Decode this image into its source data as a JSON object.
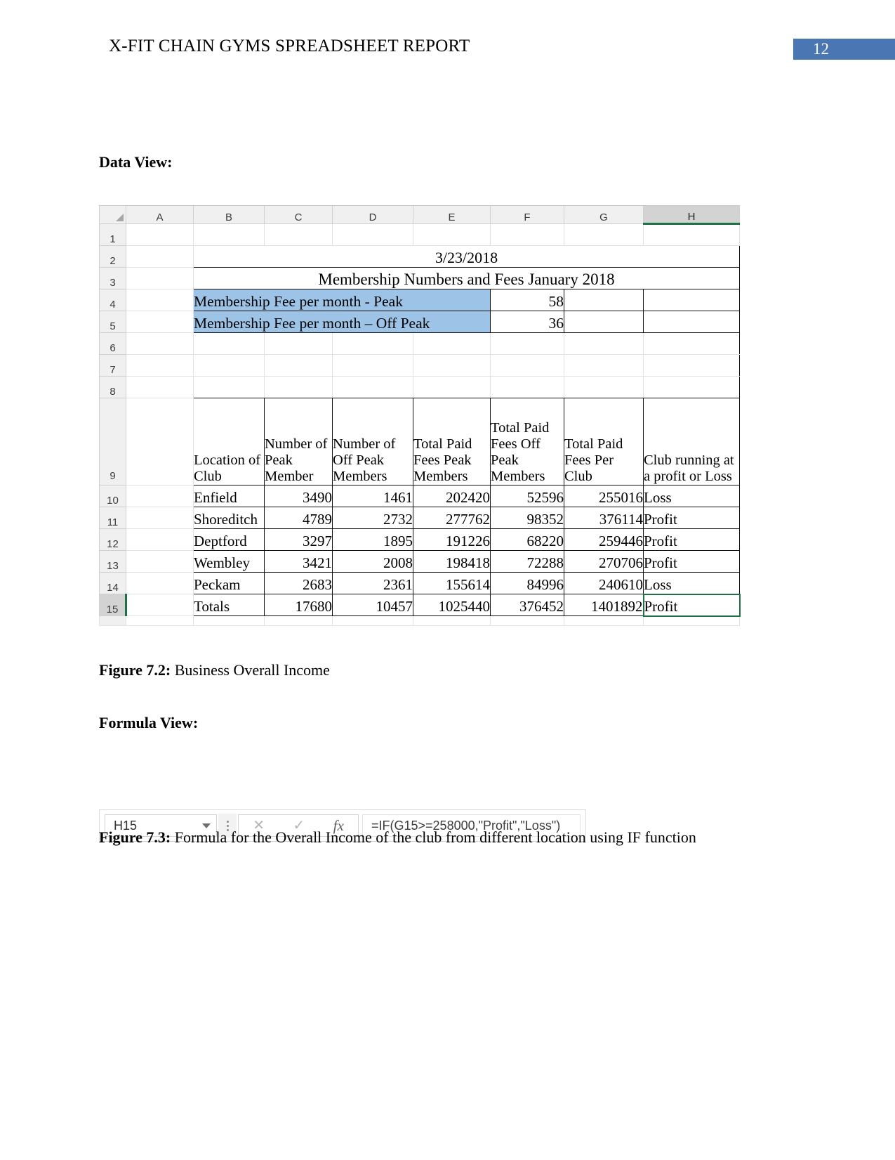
{
  "header": {
    "title": "X-FIT CHAIN GYMS SPREADSHEET REPORT",
    "page_number": "12",
    "badge_color": "#4a77b4"
  },
  "sections": {
    "data_view_label": "Data View:",
    "formula_view_label": "Formula View:"
  },
  "captions": {
    "fig72_prefix": "Figure 7.2:",
    "fig72_text": " Business Overall Income",
    "fig73_prefix": "Figure 7.3:",
    "fig73_text": " Formula for the Overall Income of the club from different location using IF function"
  },
  "spreadsheet": {
    "column_headers": [
      "A",
      "B",
      "C",
      "D",
      "E",
      "F",
      "G",
      "H"
    ],
    "selected_column": "H",
    "selected_cell": "H15",
    "row_numbers": [
      "1",
      "2",
      "3",
      "4",
      "5",
      "6",
      "7",
      "8",
      "9",
      "10",
      "11",
      "12",
      "13",
      "14",
      "15"
    ],
    "title_date": "3/23/2018",
    "title_main": "Membership Numbers and Fees January 2018",
    "fee_rows": [
      {
        "label": "Membership Fee per month - Peak",
        "value": "58"
      },
      {
        "label": "Membership Fee per month – Off Peak",
        "value": "36"
      }
    ],
    "table_headers": [
      "Location of Club",
      "Number of Peak Member",
      "Number of Off Peak Members",
      "Total Paid Fees Peak Members",
      "Total Paid Fees Off Peak Members",
      "Total Paid Fees Per Club",
      "Club running at a profit or Loss"
    ],
    "table_rows": [
      {
        "location": "Enfield",
        "peak_members": "3490",
        "offpeak_members": "1461",
        "fees_peak": "202420",
        "fees_offpeak": "52596",
        "fees_total": "255016",
        "status": "Loss"
      },
      {
        "location": "Shoreditch",
        "peak_members": "4789",
        "offpeak_members": "2732",
        "fees_peak": "277762",
        "fees_offpeak": "98352",
        "fees_total": "376114",
        "status": "Profit"
      },
      {
        "location": "Deptford",
        "peak_members": "3297",
        "offpeak_members": "1895",
        "fees_peak": "191226",
        "fees_offpeak": "68220",
        "fees_total": "259446",
        "status": "Profit"
      },
      {
        "location": "Wembley",
        "peak_members": "3421",
        "offpeak_members": "2008",
        "fees_peak": "198418",
        "fees_offpeak": "72288",
        "fees_total": "270706",
        "status": "Profit"
      },
      {
        "location": "Peckam",
        "peak_members": "2683",
        "offpeak_members": "2361",
        "fees_peak": "155614",
        "fees_offpeak": "84996",
        "fees_total": "240610",
        "status": "Loss"
      }
    ],
    "totals_row": {
      "location": "Totals",
      "peak_members": "17680",
      "offpeak_members": "10457",
      "fees_peak": "1025440",
      "fees_offpeak": "376452",
      "fees_total": "1401892",
      "status": "Profit"
    },
    "highlight_color": "#9dc3e6",
    "selection_color": "#1e7145"
  },
  "formula_bar": {
    "name_box_value": "H15",
    "cancel_icon": "✕",
    "confirm_icon": "✓",
    "function_icon": "fx",
    "formula": "=IF(G15>=258000,\"Profit\",\"Loss\")"
  }
}
